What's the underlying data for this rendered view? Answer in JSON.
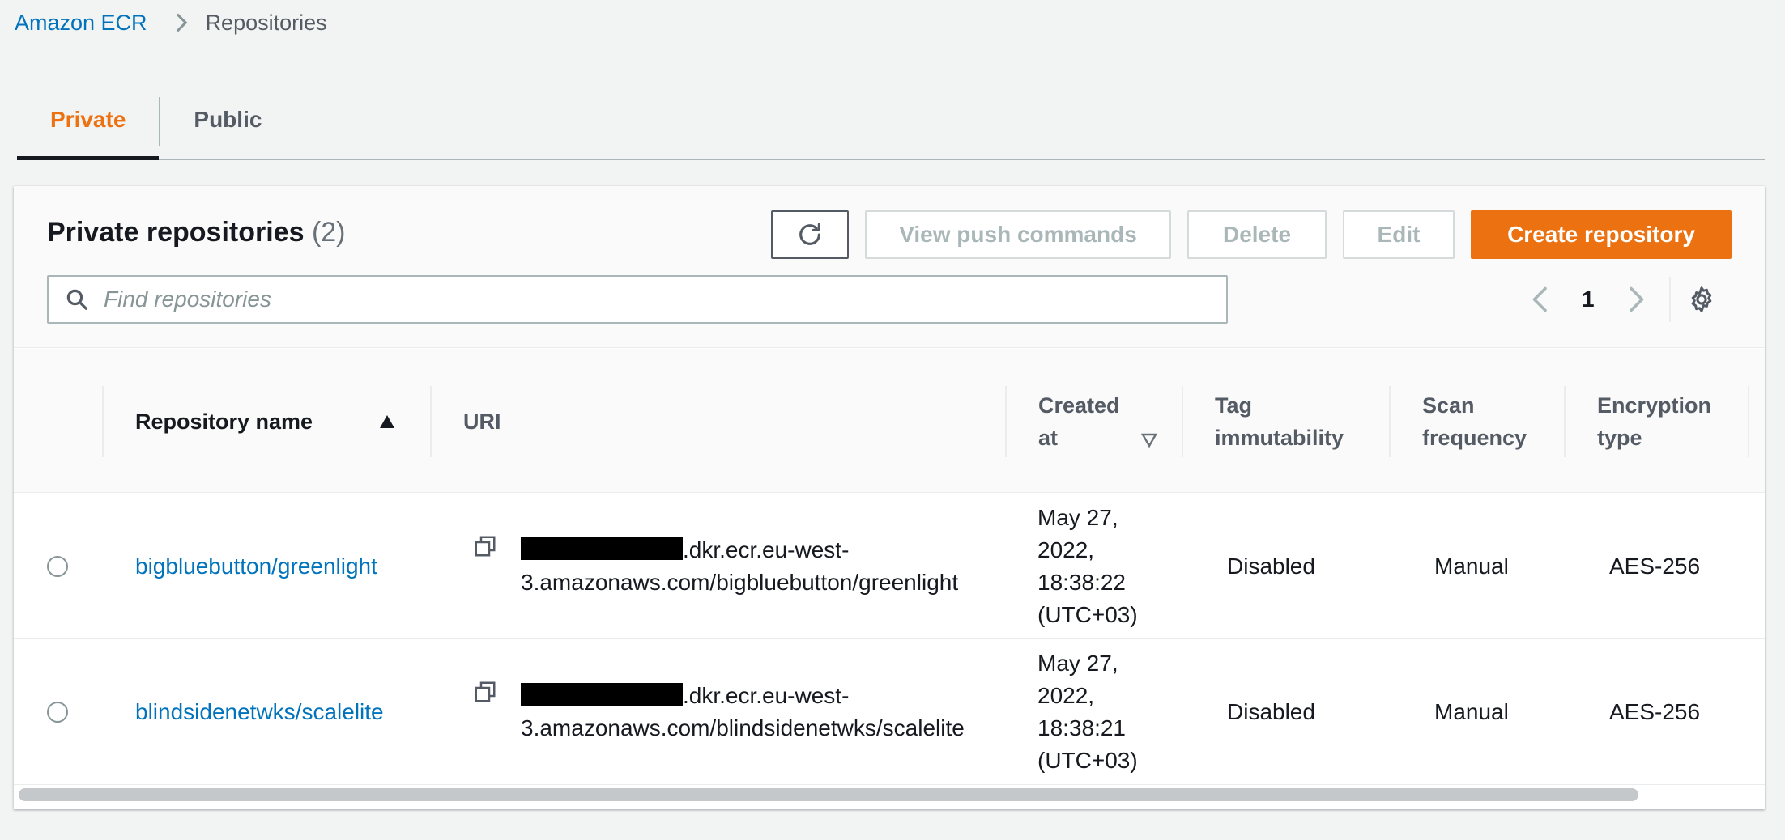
{
  "breadcrumb": {
    "service": "Amazon ECR",
    "current": "Repositories"
  },
  "tabs": [
    {
      "label": "Private",
      "active": true
    },
    {
      "label": "Public",
      "active": false
    }
  ],
  "panel": {
    "title": "Private repositories",
    "count": "(2)"
  },
  "toolbar": {
    "refresh_icon": "refresh-icon",
    "view_push_label": "View push commands",
    "delete_label": "Delete",
    "edit_label": "Edit",
    "create_label": "Create repository"
  },
  "search": {
    "placeholder": "Find repositories"
  },
  "pagination": {
    "page": "1"
  },
  "columns": {
    "name": "Repository name",
    "uri": "URI",
    "created_l1": "Created",
    "created_l2": "at",
    "tag_l1": "Tag",
    "tag_l2": "immutability",
    "scan_l1": "Scan",
    "scan_l2": "frequency",
    "enc_l1": "Encryption",
    "enc_l2": "type"
  },
  "rows": [
    {
      "name": "bigbluebutton/greenlight",
      "uri_line1": ".dkr.ecr.eu-west-",
      "uri_line2": "3.amazonaws.com/bigbluebutton/greenlight",
      "created_l1": "May 27,",
      "created_l2": "2022,",
      "created_l3": "18:38:22",
      "created_l4": "(UTC+03)",
      "tag_immutability": "Disabled",
      "scan_frequency": "Manual",
      "encryption": "AES-256"
    },
    {
      "name": "blindsidenetwks/scalelite",
      "uri_line1": ".dkr.ecr.eu-west-",
      "uri_line2": "3.amazonaws.com/blindsidenetwks/scalelite",
      "created_l1": "May 27,",
      "created_l2": "2022,",
      "created_l3": "18:38:21",
      "created_l4": "(UTC+03)",
      "tag_immutability": "Disabled",
      "scan_frequency": "Manual",
      "encryption": "AES-256"
    }
  ],
  "colors": {
    "accent": "#ec7211",
    "link": "#0073bb",
    "text": "#16191f",
    "muted": "#545b64"
  }
}
